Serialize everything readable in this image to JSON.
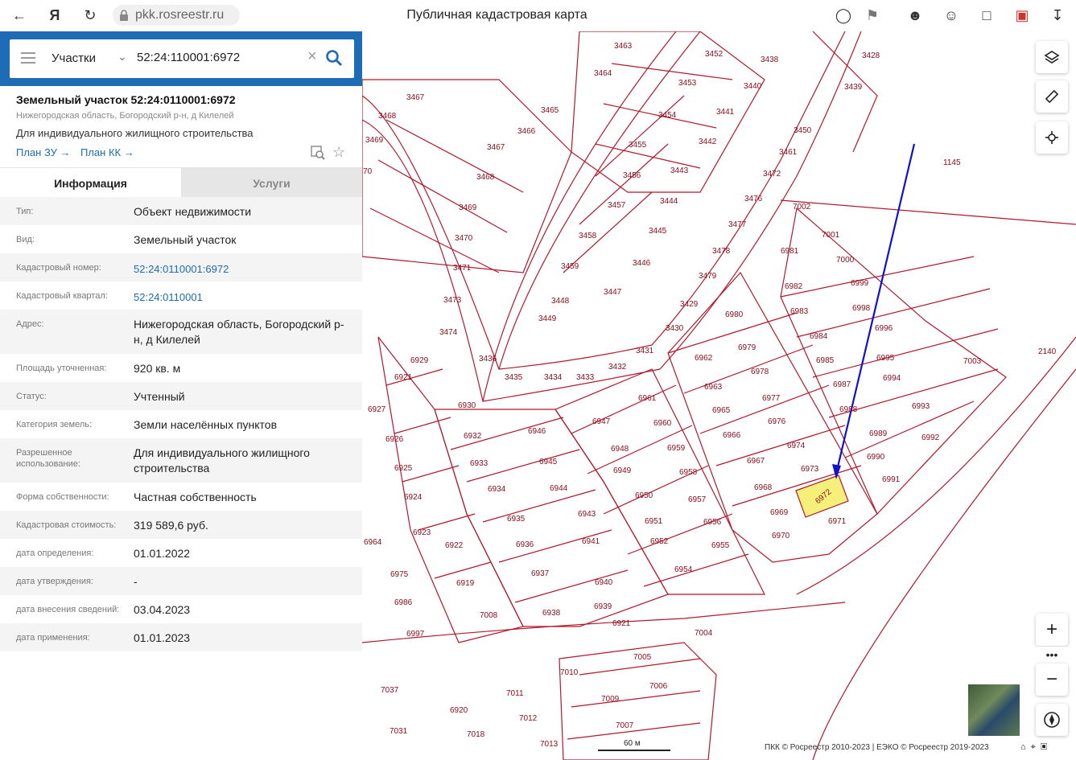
{
  "browser": {
    "url": "pkk.rosreestr.ru",
    "title": "Публичная кадастровая карта",
    "back_icon": "arrow-left-icon",
    "yandex_icon": "yandex-icon"
  },
  "search": {
    "type_label": "Участки",
    "value": "52:24:110001:6972"
  },
  "object": {
    "title": "Земельный участок 52:24:0110001:6972",
    "address": "Нижегородская область, Богородский р-н, д Килелей",
    "use": "Для индивидуального жилищного строительства",
    "plan_zu": "План ЗУ",
    "plan_kk": "План КК"
  },
  "tabs": {
    "info": "Информация",
    "services": "Услуги"
  },
  "info_rows": [
    {
      "label": "Тип:",
      "value": "Объект недвижимости"
    },
    {
      "label": "Вид:",
      "value": "Земельный участок"
    },
    {
      "label": "Кадастровый номер:",
      "value": "52:24:0110001:6972"
    },
    {
      "label": "Кадастровый квартал:",
      "value": "52:24:0110001"
    },
    {
      "label": "Адрес:",
      "value": "Нижегородская область, Богородский р-н, д Килелей"
    },
    {
      "label": "Площадь уточненная:",
      "value": "920 кв. м"
    },
    {
      "label": "Статус:",
      "value": "Учтенный"
    },
    {
      "label": "Категория земель:",
      "value": "Земли населённых пунктов"
    },
    {
      "label": "Разрешенное использование:",
      "value": "Для индивидуального жилищного строительства"
    },
    {
      "label": "Форма собственности:",
      "value": "Частная собственность"
    },
    {
      "label": "Кадастровая стоимость:",
      "value": "319 589,6 руб."
    },
    {
      "label": "дата определения:",
      "value": "01.01.2022"
    },
    {
      "label": "дата утверждения:",
      "value": "-"
    },
    {
      "label": "дата внесения сведений:",
      "value": "03.04.2023"
    },
    {
      "label": "дата применения:",
      "value": "01.01.2023"
    }
  ],
  "map": {
    "highlight_color": "#f5f07a",
    "parcel_color": "#b2182b",
    "arrow_color": "#1010d0",
    "selected_parcel": "6972",
    "scale_label": "60 м",
    "attribution": "ПКК © Росреестр 2010-2023 | ЕЭКО © Росреестр 2019-2023",
    "labels": [
      "3463",
      "3452",
      "3438",
      "3428",
      "3464",
      "3453",
      "3440",
      "3439",
      "3467",
      "3465",
      "3454",
      "3441",
      "3468",
      "3466",
      "3442",
      "3450",
      "3469",
      "3467",
      "3455",
      "3461",
      "3470",
      "3468",
      "3456",
      "3443",
      "3472",
      "3469",
      "3457",
      "3444",
      "3476",
      "7002",
      "3470",
      "3458",
      "3445",
      "3477",
      "7001",
      "3471",
      "3459",
      "3446",
      "3478",
      "6981",
      "7000",
      "3473",
      "3448",
      "3447",
      "3479",
      "6982",
      "6999",
      "3449",
      "3429",
      "6980",
      "6983",
      "6998",
      "3474",
      "3430",
      "6979",
      "6984",
      "6996",
      "3436",
      "3431",
      "6962",
      "6985",
      "6995",
      "6929",
      "3435",
      "3434",
      "3433",
      "3432",
      "6978",
      "6987",
      "6994",
      "6921",
      "6961",
      "6963",
      "6977",
      "6988",
      "6993",
      "6927",
      "6930",
      "6946",
      "6947",
      "6960",
      "6965",
      "6976",
      "6989",
      "6992",
      "6926",
      "6932",
      "6948",
      "6959",
      "6966",
      "6974",
      "6990",
      "6925",
      "6933",
      "6945",
      "6949",
      "6958",
      "6967",
      "6973",
      "6991",
      "6924",
      "6934",
      "6944",
      "6950",
      "6957",
      "6968",
      "6972",
      "6923",
      "6935",
      "6943",
      "6951",
      "6956",
      "6969",
      "6971",
      "6964",
      "6922",
      "6936",
      "6941",
      "6952",
      "6955",
      "6970",
      "6975",
      "6919",
      "6937",
      "6940",
      "6954",
      "6986",
      "6938",
      "6939",
      "7008",
      "6997",
      "6921",
      "7004",
      "7010",
      "7005",
      "7037",
      "7011",
      "7009",
      "7006",
      "6920",
      "7012",
      "7031",
      "7018",
      "7013",
      "7007",
      "1145",
      "2140",
      "7003"
    ]
  }
}
